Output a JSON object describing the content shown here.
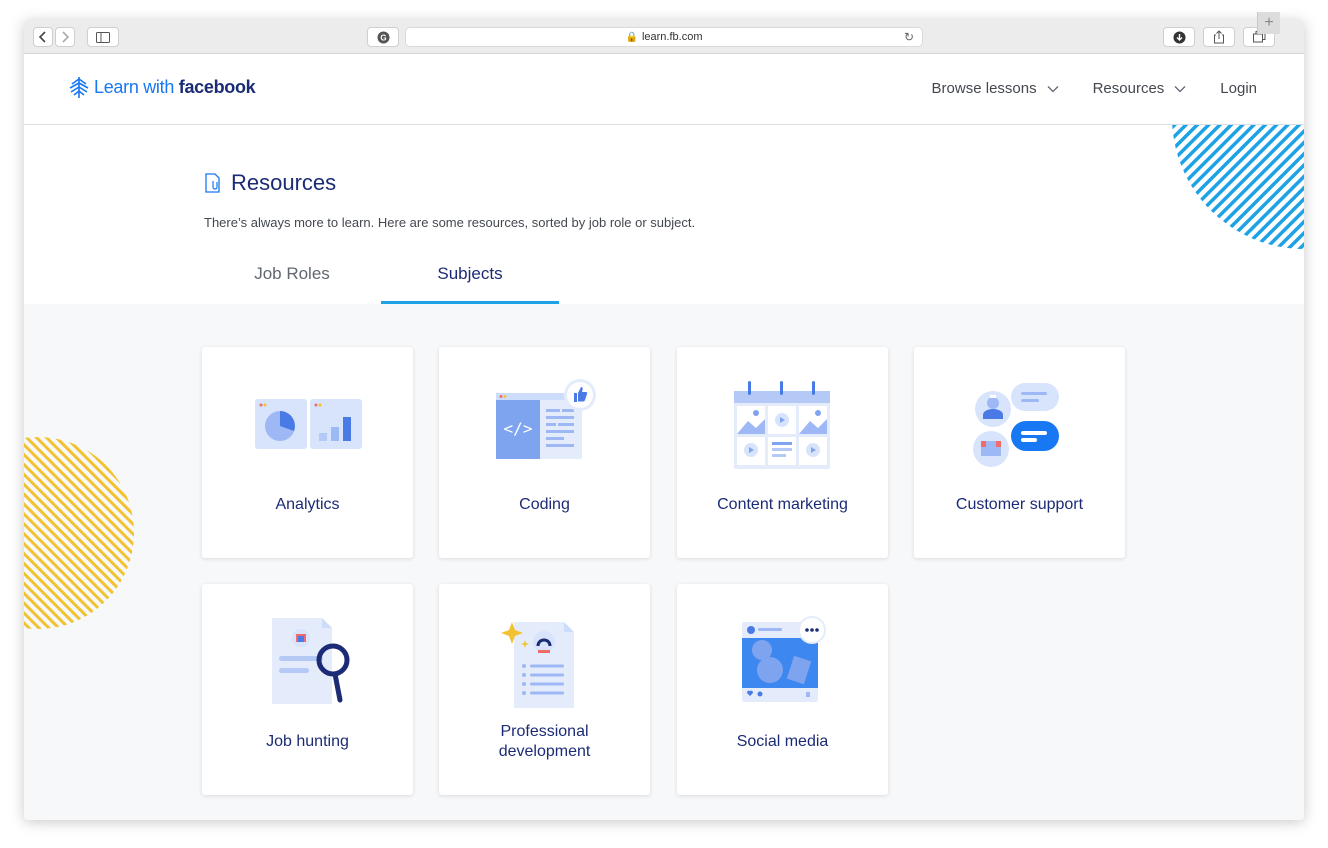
{
  "browser": {
    "url": "learn.fb.com",
    "new_tab_label": "+"
  },
  "header": {
    "logo_learn": "Learn with ",
    "logo_brand": "facebook",
    "nav": [
      {
        "label": "Browse lessons"
      },
      {
        "label": "Resources"
      },
      {
        "label": "Login"
      }
    ]
  },
  "intro": {
    "title": "Resources",
    "subtitle": "There’s always more to learn. Here are some resources, sorted by job role or subject."
  },
  "tabs": {
    "job_roles": "Job Roles",
    "subjects": "Subjects",
    "active": "Subjects"
  },
  "subjects": [
    {
      "label": "Analytics"
    },
    {
      "label": "Coding"
    },
    {
      "label": "Content marketing"
    },
    {
      "label": "Customer support"
    },
    {
      "label": "Job hunting"
    },
    {
      "label": "Professional development"
    },
    {
      "label": "Social media"
    }
  ],
  "colors": {
    "brand_navy": "#1c2b75",
    "brand_blue": "#1877f2",
    "tab_underline": "#1ea2e6",
    "deco_blue": "#1ea2e6",
    "deco_yellow": "#f2c230"
  }
}
